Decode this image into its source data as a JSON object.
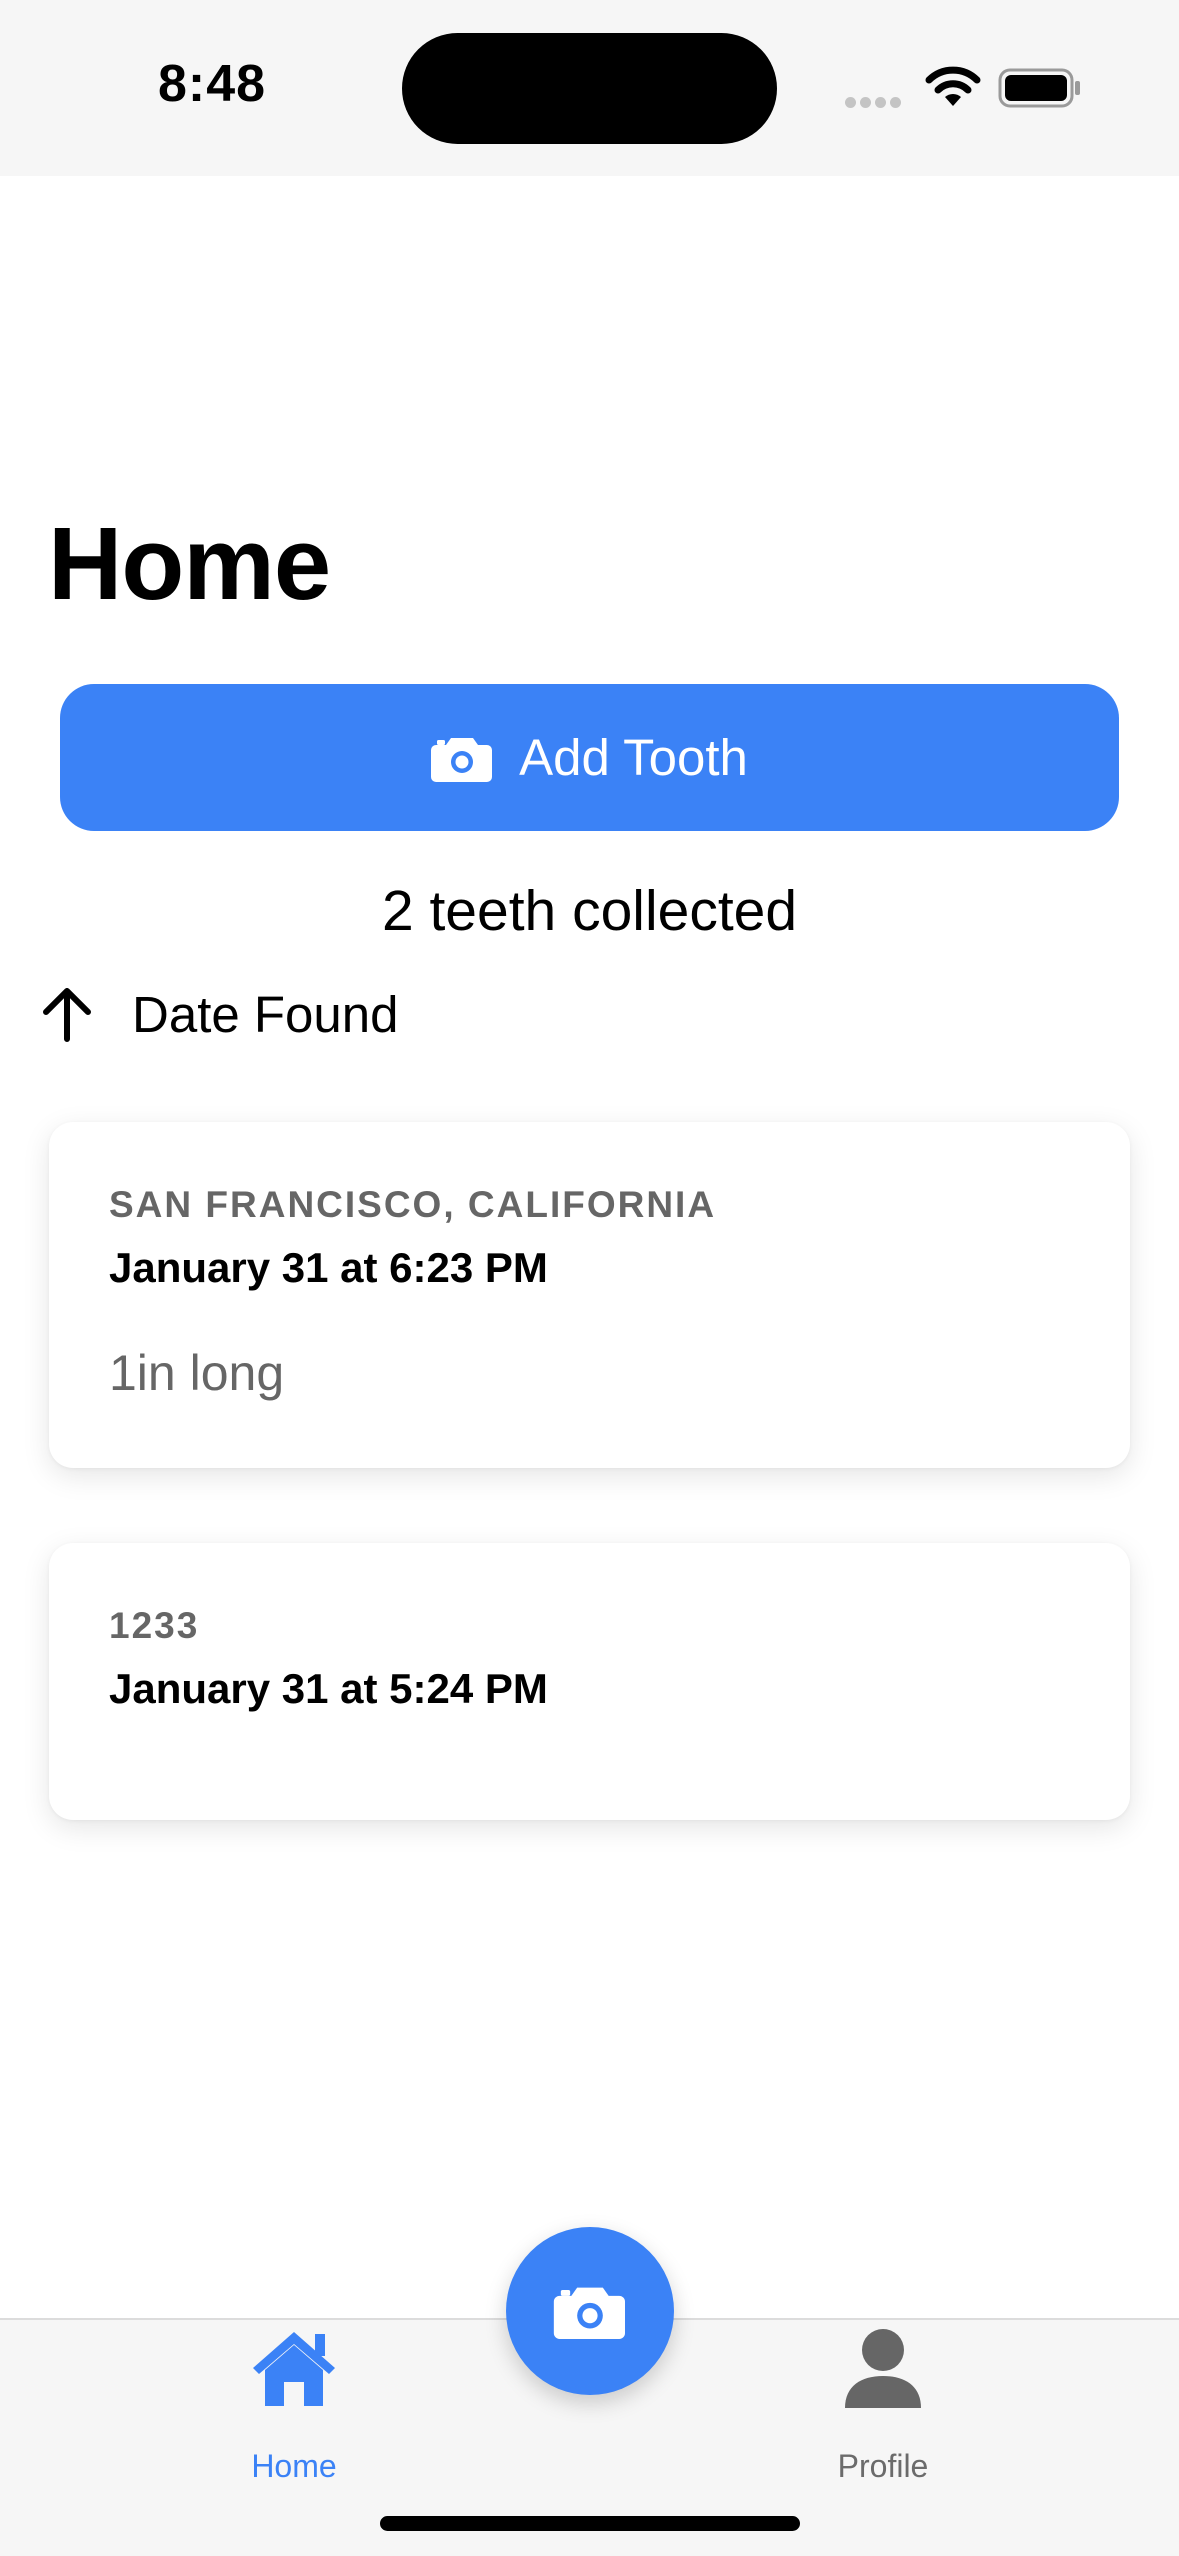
{
  "status_bar": {
    "time": "8:48"
  },
  "header": {
    "title": "Home"
  },
  "actions": {
    "add_label": "Add Tooth"
  },
  "summary": {
    "count_text": "2 teeth collected"
  },
  "sort": {
    "label": "Date Found"
  },
  "cards": [
    {
      "location": "SAN FRANCISCO, CALIFORNIA",
      "date": "January 31 at 6:23 PM",
      "length": "1in long"
    },
    {
      "location": "1233",
      "date": "January 31 at 5:24 PM",
      "length": ""
    }
  ],
  "tab_bar": {
    "home_label": "Home",
    "profile_label": "Profile"
  },
  "colors": {
    "accent": "#3b82f6",
    "secondary_text": "#666666",
    "bar_background": "#f6f6f6"
  },
  "icons": [
    "wifi-icon",
    "battery-icon",
    "camera-icon",
    "arrow-up-icon",
    "house-icon",
    "person-icon"
  ]
}
